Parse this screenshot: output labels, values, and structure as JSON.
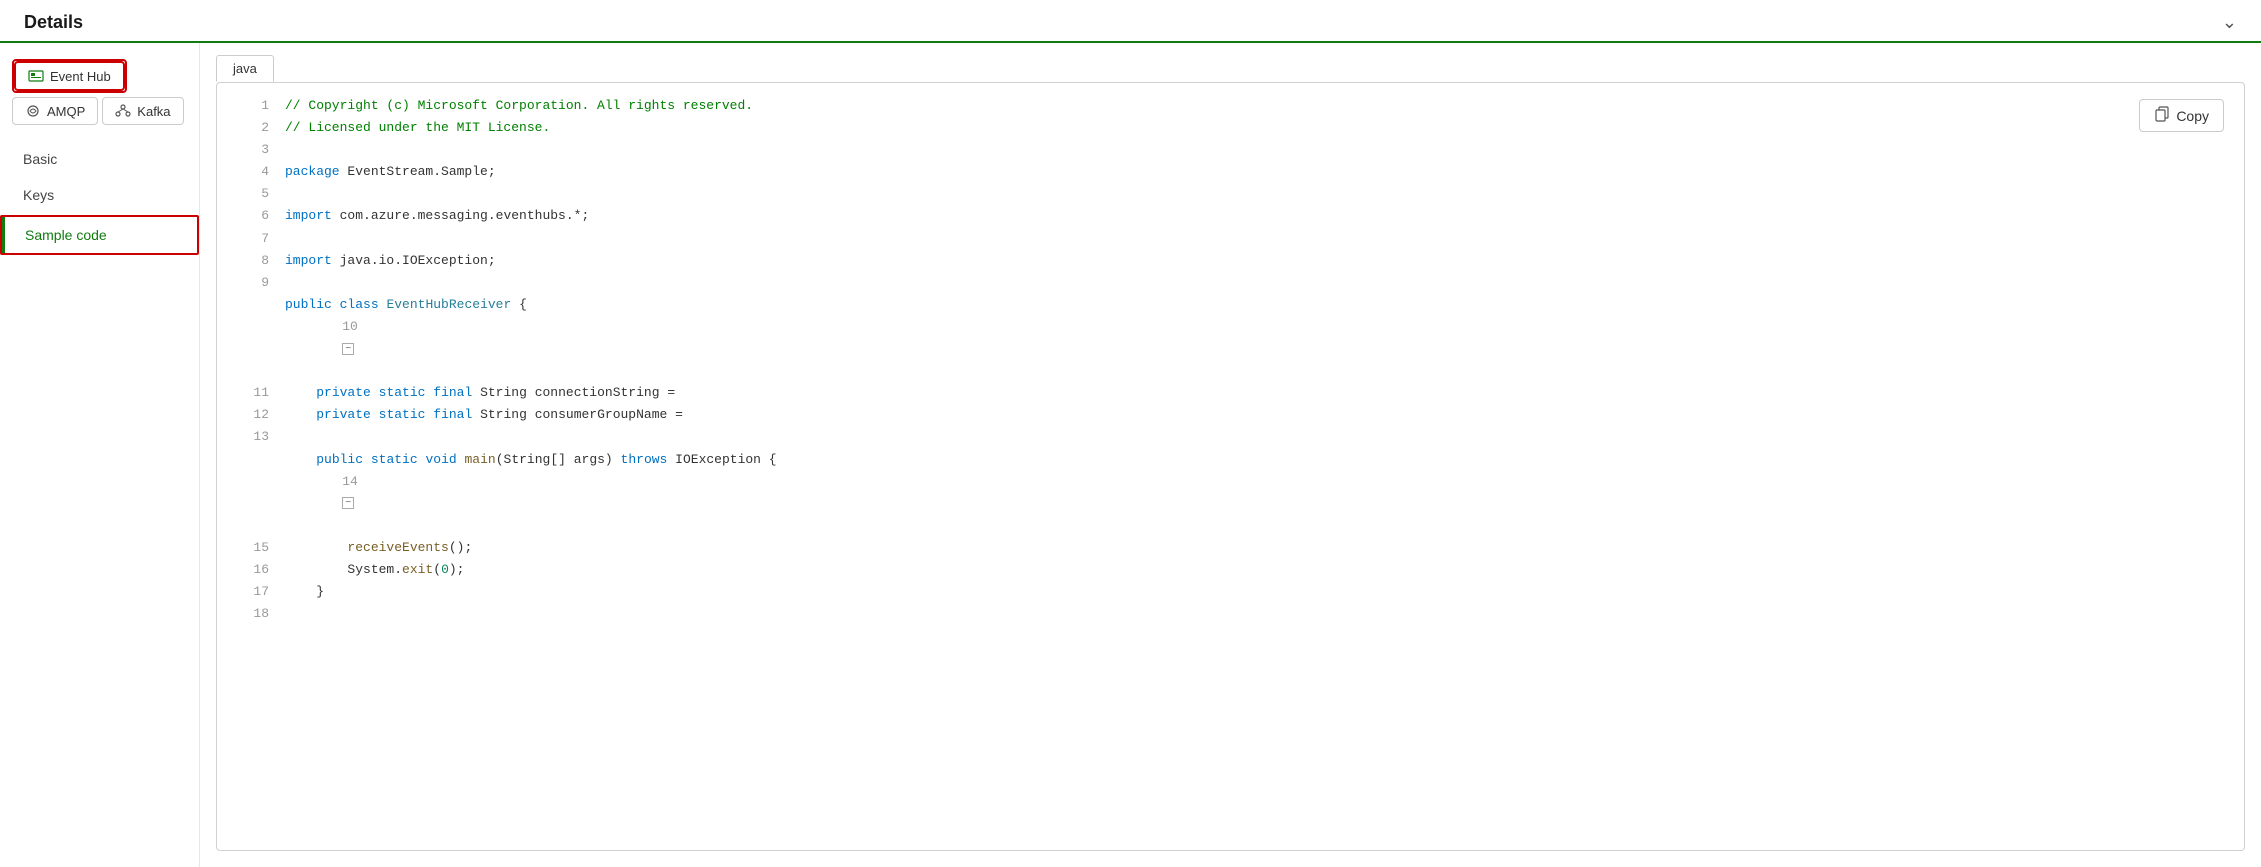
{
  "header": {
    "title": "Details",
    "chevron": "chevron-down"
  },
  "sidebar": {
    "protocol_tabs": [
      {
        "id": "event-hub",
        "label": "Event Hub",
        "icon": "event-hub-icon",
        "active": true
      },
      {
        "id": "amqp",
        "label": "AMQP",
        "icon": "amqp-icon",
        "active": false
      },
      {
        "id": "kafka",
        "label": "Kafka",
        "icon": "kafka-icon",
        "active": false
      }
    ],
    "nav_items": [
      {
        "id": "basic",
        "label": "Basic",
        "active": false
      },
      {
        "id": "keys",
        "label": "Keys",
        "active": false
      },
      {
        "id": "sample-code",
        "label": "Sample code",
        "active": true
      }
    ]
  },
  "code_panel": {
    "languages": [
      {
        "id": "java",
        "label": "java",
        "active": true
      }
    ],
    "copy_button": "Copy",
    "lines": [
      {
        "num": 1,
        "text": "// Copyright (c) Microsoft Corporation. All rights reserved.",
        "type": "comment"
      },
      {
        "num": 2,
        "text": "// Licensed under the MIT License.",
        "type": "comment"
      },
      {
        "num": 3,
        "text": "",
        "type": "blank"
      },
      {
        "num": 4,
        "text": "package EventStream.Sample;",
        "type": "code"
      },
      {
        "num": 5,
        "text": "",
        "type": "blank"
      },
      {
        "num": 6,
        "text": "import com.azure.messaging.eventhubs.*;",
        "type": "import"
      },
      {
        "num": 7,
        "text": "",
        "type": "blank"
      },
      {
        "num": 8,
        "text": "import java.io.IOException;",
        "type": "import"
      },
      {
        "num": 9,
        "text": "",
        "type": "blank"
      },
      {
        "num": 10,
        "text": "public class EventHubReceiver {",
        "type": "class",
        "foldable": true
      },
      {
        "num": 11,
        "text": "    private static final String connectionString =",
        "type": "code"
      },
      {
        "num": 12,
        "text": "    private static final String consumerGroupName =",
        "type": "code"
      },
      {
        "num": 13,
        "text": "",
        "type": "blank"
      },
      {
        "num": 14,
        "text": "    public static void main(String[] args) throws IOException {",
        "type": "code",
        "foldable": true
      },
      {
        "num": 15,
        "text": "        receiveEvents();",
        "type": "code"
      },
      {
        "num": 16,
        "text": "        System.exit(0);",
        "type": "code"
      },
      {
        "num": 17,
        "text": "    }",
        "type": "code"
      },
      {
        "num": 18,
        "text": "",
        "type": "blank"
      }
    ]
  }
}
